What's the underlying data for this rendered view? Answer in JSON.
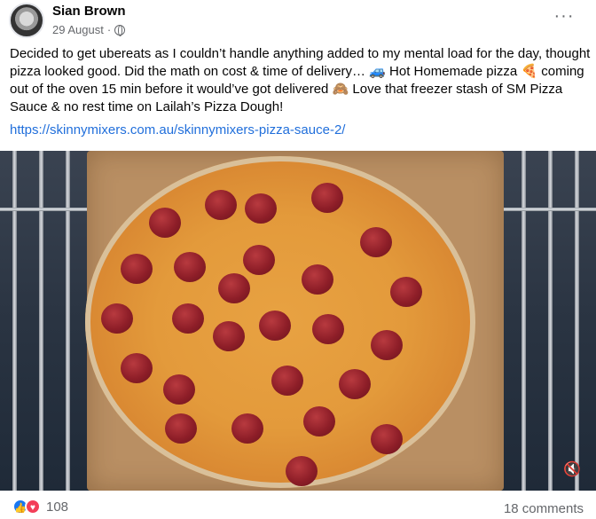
{
  "post": {
    "author": "Sian Brown",
    "date": "29 August",
    "separator": "·",
    "privacy_icon": "globe-icon",
    "more_icon": "more-options-icon",
    "more_label": "···",
    "text": "Decided to get ubereats as I couldn’t handle anything added to my mental load for the day, thought pizza looked good. Did the math on cost & time of delivery… 🚙 Hot Homemade pizza 🍕 coming out of the oven 15 min before it would’ve got delivered 🙈 Love that freezer stash of SM Pizza Sauce & no rest time on Lailah’s Pizza Dough!",
    "link": "https://skinnymixers.com.au/skinnymixers-pizza-sauce-2/",
    "media": {
      "description_icon": "mute-icon",
      "mute_glyph": "🔇"
    }
  },
  "footer": {
    "reactions_count": "108",
    "like_glyph": "👍",
    "love_glyph": "♥",
    "comments": "18 comments"
  },
  "colors": {
    "link": "#216fdb",
    "secondary_text": "#65676b",
    "like": "#1877f2",
    "love": "#f33e58"
  }
}
